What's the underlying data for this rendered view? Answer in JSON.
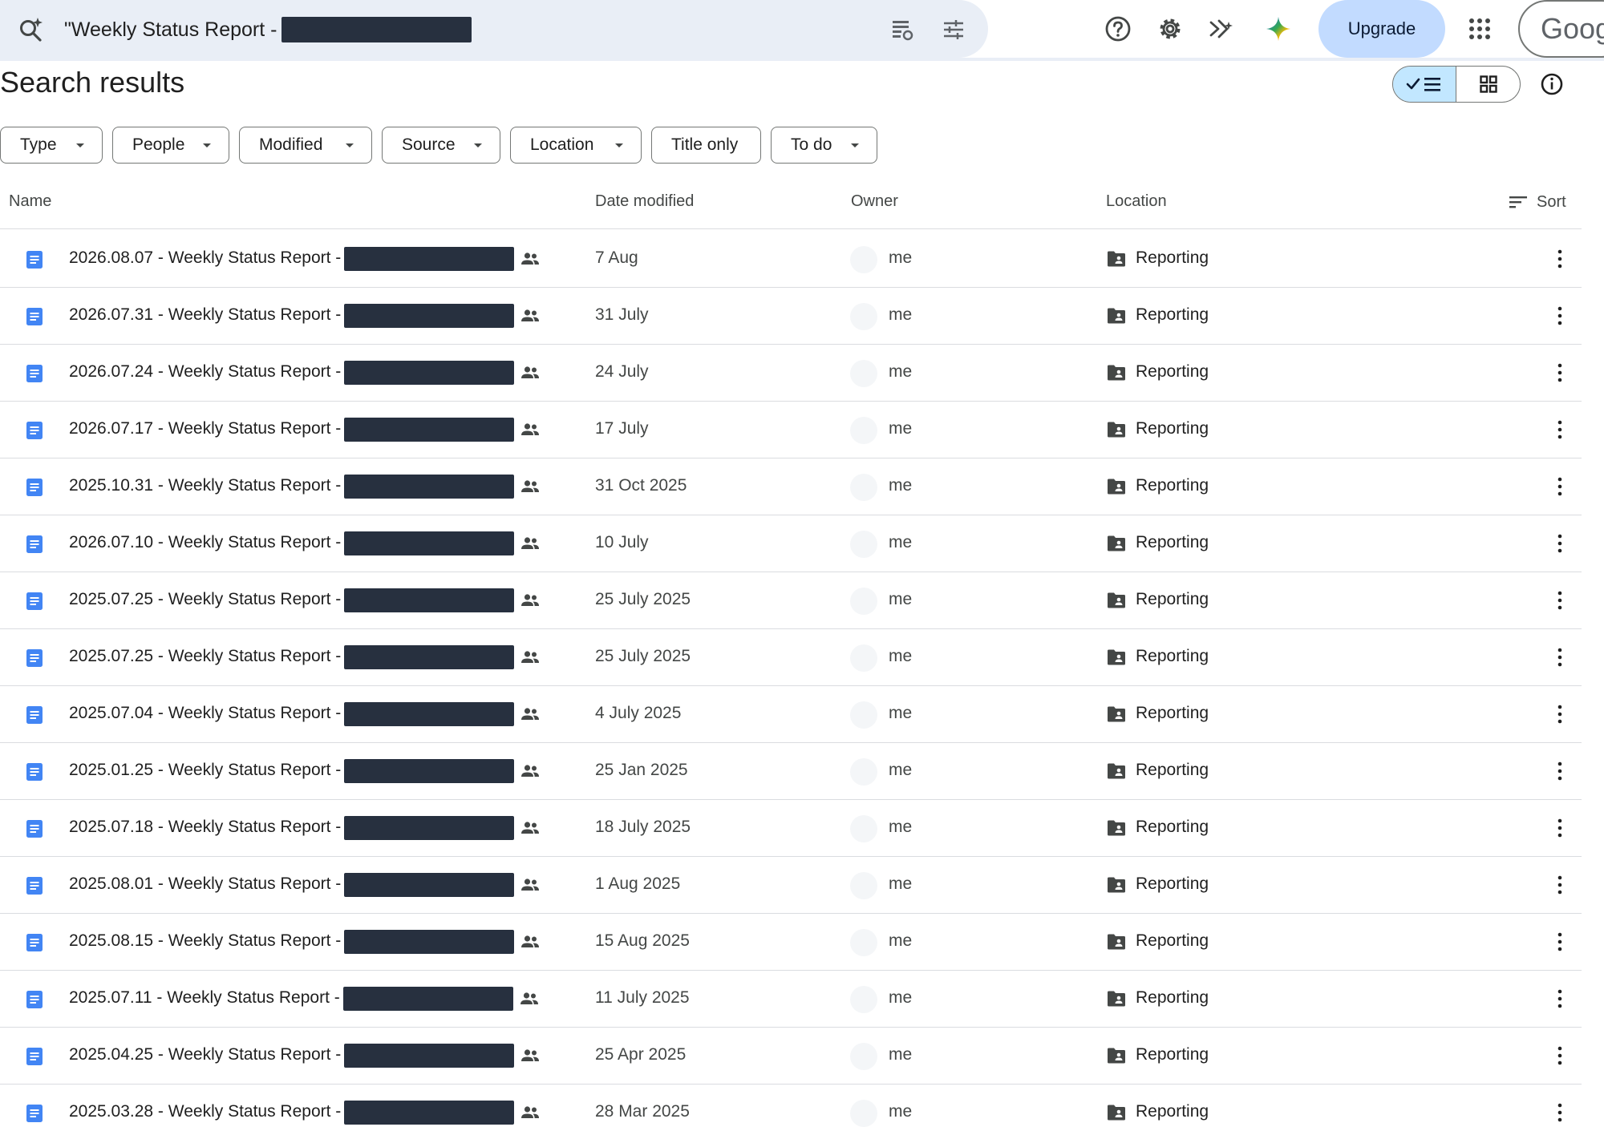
{
  "search": {
    "query": "\"Weekly Status Report - "
  },
  "topbar": {
    "upgrade_label": "Upgrade",
    "account_label": "Goog",
    "icons": [
      "search-ai-icon",
      "search-options-icon",
      "filter-tune-icon",
      "help-icon",
      "settings-icon",
      "keep-sparkle-icon",
      "gemini-icon",
      "apps-grid-icon"
    ]
  },
  "page": {
    "title": "Search results"
  },
  "filters": [
    "Type",
    "People",
    "Modified",
    "Source",
    "Location",
    "Title only",
    "To do"
  ],
  "columns": {
    "name": "Name",
    "date_modified": "Date modified",
    "owner": "Owner",
    "location": "Location",
    "sort": "Sort"
  },
  "rows": [
    {
      "name": "2026.08.07 - Weekly Status Report -",
      "date": "7 Aug",
      "owner": "me",
      "location": "Reporting"
    },
    {
      "name": "2026.07.31 - Weekly Status Report -",
      "date": "31 July",
      "owner": "me",
      "location": "Reporting"
    },
    {
      "name": "2026.07.24 - Weekly Status Report -",
      "date": "24 July",
      "owner": "me",
      "location": "Reporting"
    },
    {
      "name": "2026.07.17 - Weekly Status Report -",
      "date": "17 July",
      "owner": "me",
      "location": "Reporting"
    },
    {
      "name": "2025.10.31 - Weekly Status Report -",
      "date": "31 Oct 2025",
      "owner": "me",
      "location": "Reporting"
    },
    {
      "name": "2026.07.10 - Weekly Status Report -",
      "date": "10 July",
      "owner": "me",
      "location": "Reporting"
    },
    {
      "name": "2025.07.25 - Weekly Status Report -",
      "date": "25 July 2025",
      "owner": "me",
      "location": "Reporting"
    },
    {
      "name": "2025.07.25 - Weekly Status Report -",
      "date": "25 July 2025",
      "owner": "me",
      "location": "Reporting"
    },
    {
      "name": "2025.07.04 - Weekly Status Report -",
      "date": "4 July 2025",
      "owner": "me",
      "location": "Reporting"
    },
    {
      "name": "2025.01.25 - Weekly Status Report -",
      "date": "25 Jan 2025",
      "owner": "me",
      "location": "Reporting"
    },
    {
      "name": "2025.07.18 - Weekly Status Report -",
      "date": "18 July 2025",
      "owner": "me",
      "location": "Reporting"
    },
    {
      "name": "2025.08.01 - Weekly Status Report -",
      "date": "1 Aug 2025",
      "owner": "me",
      "location": "Reporting"
    },
    {
      "name": "2025.08.15 - Weekly Status Report -",
      "date": "15 Aug 2025",
      "owner": "me",
      "location": "Reporting"
    },
    {
      "name": "2025.07.11 - Weekly Status Report -",
      "date": "11 July 2025",
      "owner": "me",
      "location": "Reporting"
    },
    {
      "name": "2025.04.25 - Weekly Status Report -",
      "date": "25 Apr 2025",
      "owner": "me",
      "location": "Reporting"
    },
    {
      "name": "2025.03.28 - Weekly Status Report -",
      "date": "28 Mar 2025",
      "owner": "me",
      "location": "Reporting"
    }
  ],
  "colors": {
    "search_bg": "#e9eef6",
    "upgrade_bg": "#c2dbff",
    "active_view_bg": "#c2e7ff",
    "doc_icon": "#4285f4",
    "redaction": "#27303f"
  }
}
